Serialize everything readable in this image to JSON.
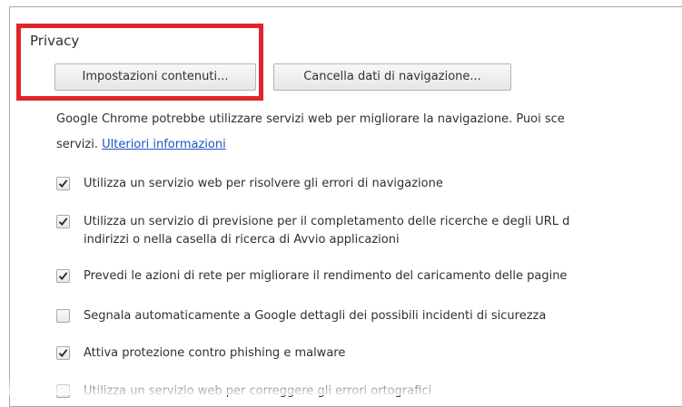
{
  "privacy": {
    "title": "Privacy",
    "content_settings_button": "Impostazioni contenuti...",
    "clear_browsing_button": "Cancella dati di navigazione...",
    "description_line1": "Google Chrome potrebbe utilizzare servizi web per migliorare la navigazione. Puoi sce",
    "description_line2_prefix": "servizi. ",
    "learn_more_link": "Ulteriori informazioni",
    "options": [
      {
        "label_line1": "Utilizza un servizio web per risolvere gli errori di navigazione",
        "label_line2": "",
        "checked": true
      },
      {
        "label_line1": "Utilizza un servizio di previsione per il completamento delle ricerche e degli URL d",
        "label_line2": "indirizzi o nella casella di ricerca di Avvio applicazioni",
        "checked": true
      },
      {
        "label_line1": "Prevedi le azioni di rete per migliorare il rendimento del caricamento delle pagine",
        "label_line2": "",
        "checked": true
      },
      {
        "label_line1": "Segnala automaticamente a Google dettagli dei possibili incidenti di sicurezza",
        "label_line2": "",
        "checked": false
      },
      {
        "label_line1": "Attiva protezione contro phishing e malware",
        "label_line2": "",
        "checked": true
      },
      {
        "label_line1": "Utilizza un servizio web per correggere gli errori ortografici",
        "label_line2": "",
        "checked": false
      }
    ]
  },
  "colors": {
    "highlight": "#e1252b",
    "link": "#1a55c0",
    "text": "#303030"
  },
  "icons": {
    "checkmark": "check-icon"
  }
}
